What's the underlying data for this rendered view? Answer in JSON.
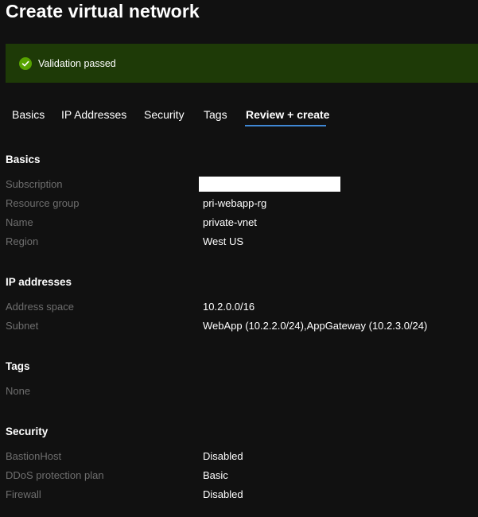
{
  "page": {
    "title": "Create virtual network"
  },
  "banner": {
    "text": "Validation passed",
    "icon": "checkmark-circle-icon",
    "color": "#57a300"
  },
  "tabs": [
    {
      "label": "Basics"
    },
    {
      "label": "IP Addresses"
    },
    {
      "label": "Security"
    },
    {
      "label": "Tags"
    },
    {
      "label": "Review + create",
      "active": true
    }
  ],
  "basics": {
    "heading": "Basics",
    "subscription_label": "Subscription",
    "subscription_value": "",
    "resource_group_label": "Resource group",
    "resource_group_value": "pri-webapp-rg",
    "name_label": "Name",
    "name_value": "private-vnet",
    "region_label": "Region",
    "region_value": "West US"
  },
  "ip": {
    "heading": "IP addresses",
    "address_space_label": "Address space",
    "address_space_value": "10.2.0.0/16",
    "subnet_label": "Subnet",
    "subnet_value": "WebApp (10.2.2.0/24),AppGateway (10.2.3.0/24)"
  },
  "tags": {
    "heading": "Tags",
    "none_label": "None"
  },
  "security": {
    "heading": "Security",
    "bastion_label": "BastionHost",
    "bastion_value": "Disabled",
    "ddos_label": "DDoS protection plan",
    "ddos_value": "Basic",
    "firewall_label": "Firewall",
    "firewall_value": "Disabled"
  },
  "colors": {
    "background": "#111111",
    "banner": "#1e3a07",
    "accent": "#3f87d4",
    "label": "#6e6e6e"
  }
}
